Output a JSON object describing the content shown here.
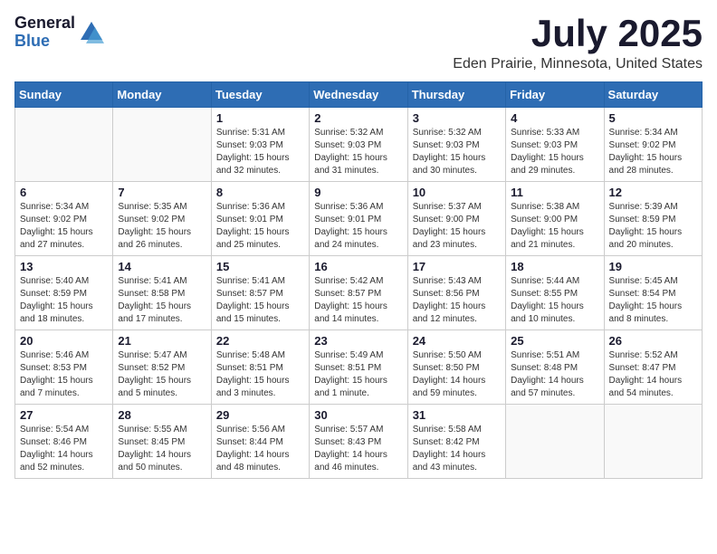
{
  "header": {
    "logo": {
      "general": "General",
      "blue": "Blue"
    },
    "title": "July 2025",
    "location": "Eden Prairie, Minnesota, United States"
  },
  "weekdays": [
    "Sunday",
    "Monday",
    "Tuesday",
    "Wednesday",
    "Thursday",
    "Friday",
    "Saturday"
  ],
  "weeks": [
    [
      {
        "day": "",
        "detail": ""
      },
      {
        "day": "",
        "detail": ""
      },
      {
        "day": "1",
        "detail": "Sunrise: 5:31 AM\nSunset: 9:03 PM\nDaylight: 15 hours\nand 32 minutes."
      },
      {
        "day": "2",
        "detail": "Sunrise: 5:32 AM\nSunset: 9:03 PM\nDaylight: 15 hours\nand 31 minutes."
      },
      {
        "day": "3",
        "detail": "Sunrise: 5:32 AM\nSunset: 9:03 PM\nDaylight: 15 hours\nand 30 minutes."
      },
      {
        "day": "4",
        "detail": "Sunrise: 5:33 AM\nSunset: 9:03 PM\nDaylight: 15 hours\nand 29 minutes."
      },
      {
        "day": "5",
        "detail": "Sunrise: 5:34 AM\nSunset: 9:02 PM\nDaylight: 15 hours\nand 28 minutes."
      }
    ],
    [
      {
        "day": "6",
        "detail": "Sunrise: 5:34 AM\nSunset: 9:02 PM\nDaylight: 15 hours\nand 27 minutes."
      },
      {
        "day": "7",
        "detail": "Sunrise: 5:35 AM\nSunset: 9:02 PM\nDaylight: 15 hours\nand 26 minutes."
      },
      {
        "day": "8",
        "detail": "Sunrise: 5:36 AM\nSunset: 9:01 PM\nDaylight: 15 hours\nand 25 minutes."
      },
      {
        "day": "9",
        "detail": "Sunrise: 5:36 AM\nSunset: 9:01 PM\nDaylight: 15 hours\nand 24 minutes."
      },
      {
        "day": "10",
        "detail": "Sunrise: 5:37 AM\nSunset: 9:00 PM\nDaylight: 15 hours\nand 23 minutes."
      },
      {
        "day": "11",
        "detail": "Sunrise: 5:38 AM\nSunset: 9:00 PM\nDaylight: 15 hours\nand 21 minutes."
      },
      {
        "day": "12",
        "detail": "Sunrise: 5:39 AM\nSunset: 8:59 PM\nDaylight: 15 hours\nand 20 minutes."
      }
    ],
    [
      {
        "day": "13",
        "detail": "Sunrise: 5:40 AM\nSunset: 8:59 PM\nDaylight: 15 hours\nand 18 minutes."
      },
      {
        "day": "14",
        "detail": "Sunrise: 5:41 AM\nSunset: 8:58 PM\nDaylight: 15 hours\nand 17 minutes."
      },
      {
        "day": "15",
        "detail": "Sunrise: 5:41 AM\nSunset: 8:57 PM\nDaylight: 15 hours\nand 15 minutes."
      },
      {
        "day": "16",
        "detail": "Sunrise: 5:42 AM\nSunset: 8:57 PM\nDaylight: 15 hours\nand 14 minutes."
      },
      {
        "day": "17",
        "detail": "Sunrise: 5:43 AM\nSunset: 8:56 PM\nDaylight: 15 hours\nand 12 minutes."
      },
      {
        "day": "18",
        "detail": "Sunrise: 5:44 AM\nSunset: 8:55 PM\nDaylight: 15 hours\nand 10 minutes."
      },
      {
        "day": "19",
        "detail": "Sunrise: 5:45 AM\nSunset: 8:54 PM\nDaylight: 15 hours\nand 8 minutes."
      }
    ],
    [
      {
        "day": "20",
        "detail": "Sunrise: 5:46 AM\nSunset: 8:53 PM\nDaylight: 15 hours\nand 7 minutes."
      },
      {
        "day": "21",
        "detail": "Sunrise: 5:47 AM\nSunset: 8:52 PM\nDaylight: 15 hours\nand 5 minutes."
      },
      {
        "day": "22",
        "detail": "Sunrise: 5:48 AM\nSunset: 8:51 PM\nDaylight: 15 hours\nand 3 minutes."
      },
      {
        "day": "23",
        "detail": "Sunrise: 5:49 AM\nSunset: 8:51 PM\nDaylight: 15 hours\nand 1 minute."
      },
      {
        "day": "24",
        "detail": "Sunrise: 5:50 AM\nSunset: 8:50 PM\nDaylight: 14 hours\nand 59 minutes."
      },
      {
        "day": "25",
        "detail": "Sunrise: 5:51 AM\nSunset: 8:48 PM\nDaylight: 14 hours\nand 57 minutes."
      },
      {
        "day": "26",
        "detail": "Sunrise: 5:52 AM\nSunset: 8:47 PM\nDaylight: 14 hours\nand 54 minutes."
      }
    ],
    [
      {
        "day": "27",
        "detail": "Sunrise: 5:54 AM\nSunset: 8:46 PM\nDaylight: 14 hours\nand 52 minutes."
      },
      {
        "day": "28",
        "detail": "Sunrise: 5:55 AM\nSunset: 8:45 PM\nDaylight: 14 hours\nand 50 minutes."
      },
      {
        "day": "29",
        "detail": "Sunrise: 5:56 AM\nSunset: 8:44 PM\nDaylight: 14 hours\nand 48 minutes."
      },
      {
        "day": "30",
        "detail": "Sunrise: 5:57 AM\nSunset: 8:43 PM\nDaylight: 14 hours\nand 46 minutes."
      },
      {
        "day": "31",
        "detail": "Sunrise: 5:58 AM\nSunset: 8:42 PM\nDaylight: 14 hours\nand 43 minutes."
      },
      {
        "day": "",
        "detail": ""
      },
      {
        "day": "",
        "detail": ""
      }
    ]
  ]
}
